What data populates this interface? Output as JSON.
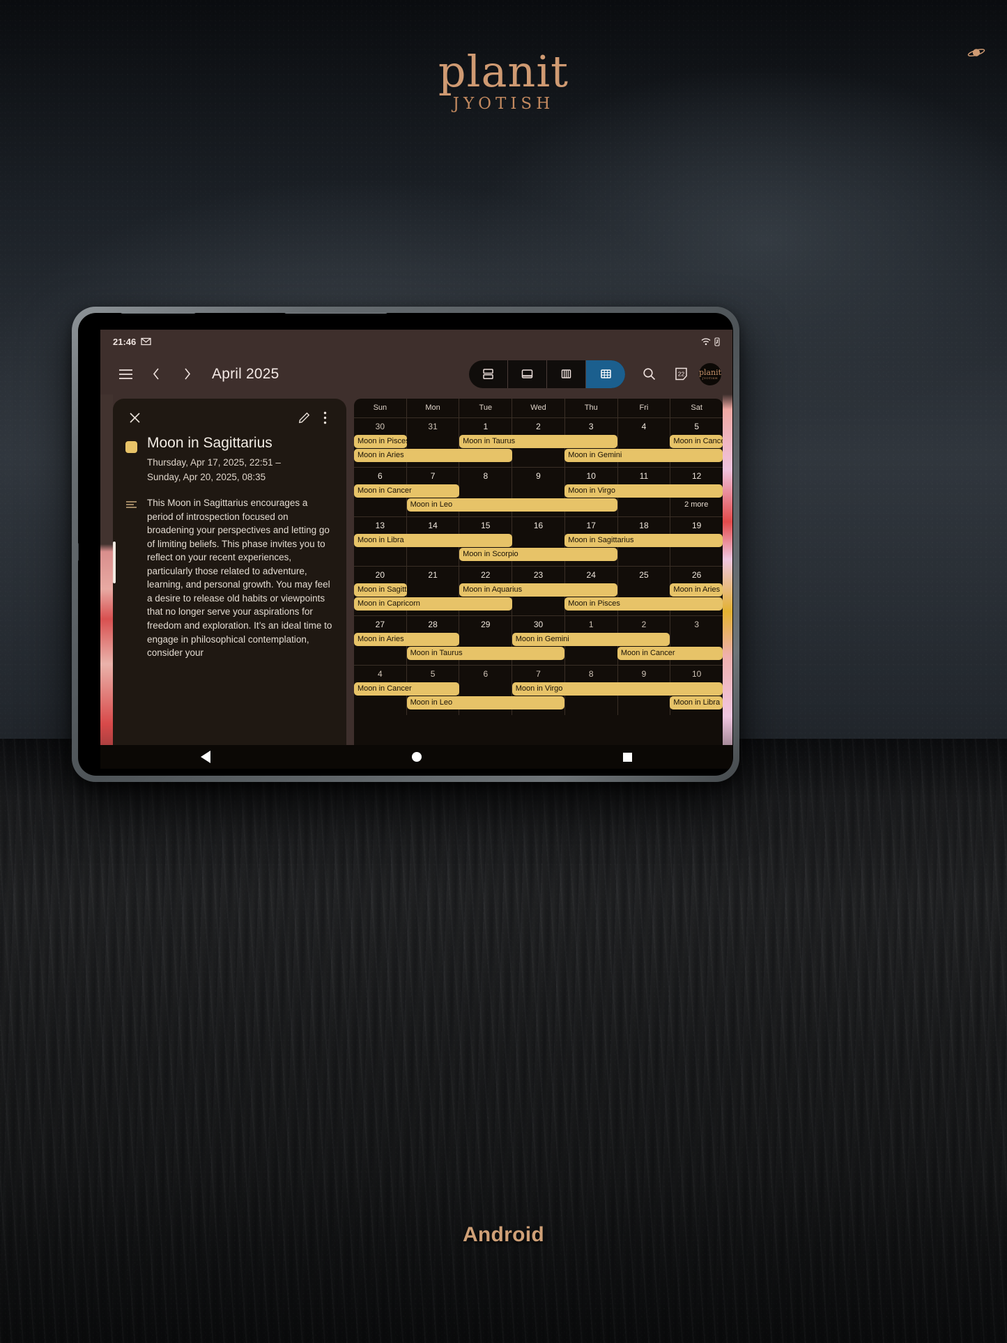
{
  "brand": {
    "word": "planit",
    "sub": "JYOTISH",
    "planet_icon": "saturn-icon",
    "accent": "#cf9a72"
  },
  "caption": "Android",
  "device": {
    "platform": "Android",
    "type": "tablet"
  },
  "statusbar": {
    "time": "21:46",
    "icons": [
      "gmail-icon",
      "wifi-icon",
      "battery-icon"
    ]
  },
  "header": {
    "menu_icon": "hamburger-menu-icon",
    "prev_icon": "chevron-left-icon",
    "next_icon": "chevron-right-icon",
    "title": "April 2025",
    "views": [
      {
        "id": "schedule",
        "icon": "schedule-view-icon",
        "active": false
      },
      {
        "id": "day",
        "icon": "day-view-icon",
        "active": false
      },
      {
        "id": "week",
        "icon": "week-view-icon",
        "active": false
      },
      {
        "id": "month",
        "icon": "month-view-icon",
        "active": true
      }
    ],
    "search_icon": "search-icon",
    "today_icon": "calendar-today-icon",
    "today_number": "22",
    "avatar": {
      "icon": "profile-avatar",
      "line1": "planit",
      "line2": "JYOTISH"
    },
    "active_accent": "#1b5f8e"
  },
  "detail_panel": {
    "close_icon": "close-icon",
    "edit_icon": "edit-pencil-icon",
    "more_icon": "more-vertical-icon",
    "color_swatch": "#e8c368",
    "title": "Moon in Sagittarius",
    "date_line1": "Thursday, Apr 17, 2025, 22:51 –",
    "date_line2": "Sunday, Apr 20, 2025, 08:35",
    "description_icon": "description-lines-icon",
    "description": "This Moon in Sagittarius encourages a period of introspection focused on broadening your perspectives and letting go of limiting beliefs. This phase invites you to reflect on your recent experiences, particularly those related to adventure, learning, and personal growth. You may feel a desire to release old habits or viewpoints that no longer serve your aspirations for freedom and exploration. It’s an ideal time to engage in philosophical contemplation, consider your"
  },
  "calendar": {
    "day_headers": [
      "Sun",
      "Mon",
      "Tue",
      "Wed",
      "Thu",
      "Fri",
      "Sat"
    ],
    "chip_color": "#e7c368",
    "more_label": "2 more",
    "weeks": [
      {
        "days": [
          {
            "num": "30",
            "dim": true
          },
          {
            "num": "31",
            "dim": true
          },
          {
            "num": "1",
            "dim": false
          },
          {
            "num": "2",
            "dim": false
          },
          {
            "num": "3",
            "dim": false
          },
          {
            "num": "4",
            "dim": false
          },
          {
            "num": "5",
            "dim": false
          }
        ],
        "events": [
          {
            "label": "Moon in Pisces",
            "start": 0,
            "span": 1,
            "row": 0
          },
          {
            "label": "Moon in Taurus",
            "start": 2,
            "span": 3,
            "row": 0
          },
          {
            "label": "Moon in Cancer",
            "start": 6,
            "span": 1,
            "row": 0
          },
          {
            "label": "Moon in Aries",
            "start": 0,
            "span": 3,
            "row": 1
          },
          {
            "label": "Moon in Gemini",
            "start": 4,
            "span": 3,
            "row": 1
          }
        ],
        "more": null
      },
      {
        "days": [
          {
            "num": "6",
            "dim": false
          },
          {
            "num": "7",
            "dim": false
          },
          {
            "num": "8",
            "dim": false
          },
          {
            "num": "9",
            "dim": false
          },
          {
            "num": "10",
            "dim": false
          },
          {
            "num": "11",
            "dim": false
          },
          {
            "num": "12",
            "dim": false
          }
        ],
        "events": [
          {
            "label": "Moon in Cancer",
            "start": 0,
            "span": 2,
            "row": 0
          },
          {
            "label": "Moon in Virgo",
            "start": 4,
            "span": 3,
            "row": 0
          },
          {
            "label": "Moon in Leo",
            "start": 1,
            "span": 4,
            "row": 1
          }
        ],
        "more": {
          "label": "2 more",
          "start": 6,
          "row": 1
        }
      },
      {
        "days": [
          {
            "num": "13",
            "dim": false
          },
          {
            "num": "14",
            "dim": false
          },
          {
            "num": "15",
            "dim": false
          },
          {
            "num": "16",
            "dim": false
          },
          {
            "num": "17",
            "dim": false
          },
          {
            "num": "18",
            "dim": false
          },
          {
            "num": "19",
            "dim": false
          }
        ],
        "events": [
          {
            "label": "Moon in Libra",
            "start": 0,
            "span": 3,
            "row": 0
          },
          {
            "label": "Moon in Sagittarius",
            "start": 4,
            "span": 3,
            "row": 0
          },
          {
            "label": "Moon in Scorpio",
            "start": 2,
            "span": 3,
            "row": 1
          }
        ],
        "more": null
      },
      {
        "days": [
          {
            "num": "20",
            "dim": false
          },
          {
            "num": "21",
            "dim": false
          },
          {
            "num": "22",
            "dim": false
          },
          {
            "num": "23",
            "dim": false
          },
          {
            "num": "24",
            "dim": false
          },
          {
            "num": "25",
            "dim": false
          },
          {
            "num": "26",
            "dim": false
          }
        ],
        "events": [
          {
            "label": "Moon in Sagitta",
            "start": 0,
            "span": 1,
            "row": 0
          },
          {
            "label": "Moon in Aquarius",
            "start": 2,
            "span": 3,
            "row": 0
          },
          {
            "label": "Moon in Aries",
            "start": 6,
            "span": 1,
            "row": 0
          },
          {
            "label": "Moon in Capricorn",
            "start": 0,
            "span": 3,
            "row": 1
          },
          {
            "label": "Moon in Pisces",
            "start": 4,
            "span": 3,
            "row": 1
          }
        ],
        "more": null
      },
      {
        "days": [
          {
            "num": "27",
            "dim": false
          },
          {
            "num": "28",
            "dim": false
          },
          {
            "num": "29",
            "dim": false
          },
          {
            "num": "30",
            "dim": false
          },
          {
            "num": "1",
            "dim": true
          },
          {
            "num": "2",
            "dim": true
          },
          {
            "num": "3",
            "dim": true
          }
        ],
        "events": [
          {
            "label": "Moon in Aries",
            "start": 0,
            "span": 2,
            "row": 0
          },
          {
            "label": "Moon in Gemini",
            "start": 3,
            "span": 3,
            "row": 0
          },
          {
            "label": "Moon in Taurus",
            "start": 1,
            "span": 3,
            "row": 1
          },
          {
            "label": "Moon in Cancer",
            "start": 5,
            "span": 2,
            "row": 1
          }
        ],
        "more": null
      },
      {
        "days": [
          {
            "num": "4",
            "dim": true
          },
          {
            "num": "5",
            "dim": true
          },
          {
            "num": "6",
            "dim": true
          },
          {
            "num": "7",
            "dim": true
          },
          {
            "num": "8",
            "dim": true
          },
          {
            "num": "9",
            "dim": true
          },
          {
            "num": "10",
            "dim": true
          }
        ],
        "events": [
          {
            "label": "Moon in Cancer",
            "start": 0,
            "span": 2,
            "row": 0
          },
          {
            "label": "Moon in Virgo",
            "start": 3,
            "span": 4,
            "row": 0
          },
          {
            "label": "Moon in Leo",
            "start": 1,
            "span": 3,
            "row": 1
          },
          {
            "label": "Moon in Libra",
            "start": 6,
            "span": 1,
            "row": 1
          }
        ],
        "more": null
      }
    ]
  },
  "navbar": {
    "back_icon": "nav-back-icon",
    "home_icon": "nav-home-icon",
    "recents_icon": "nav-recents-icon"
  }
}
